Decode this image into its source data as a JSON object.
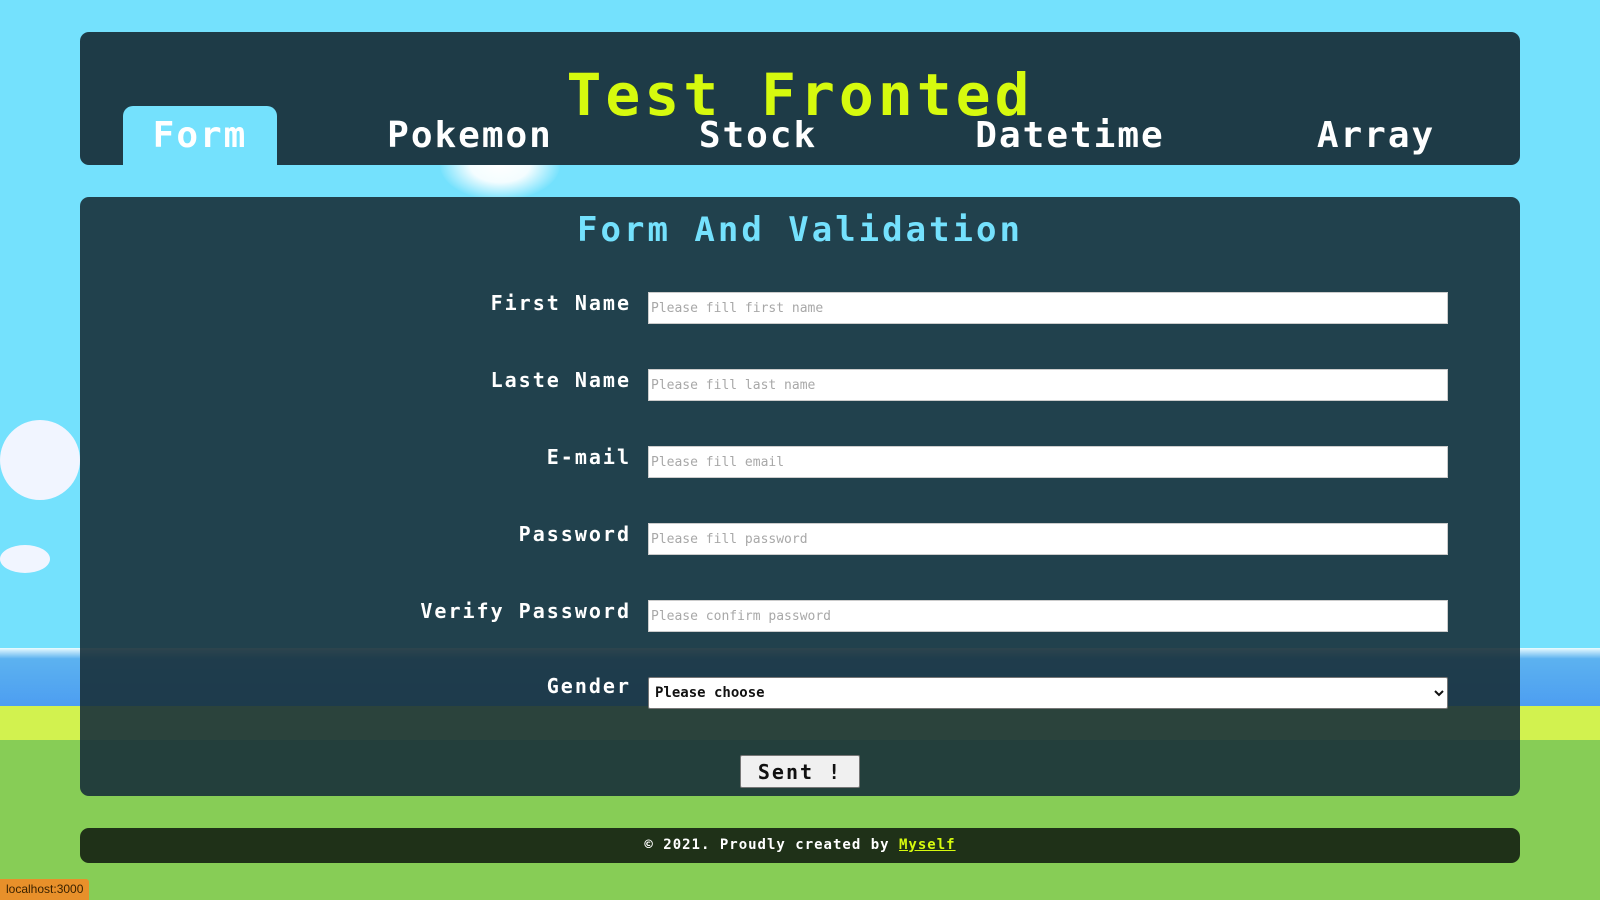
{
  "header": {
    "title": "Test Fronted",
    "tabs": [
      {
        "label": "Form",
        "active": true
      },
      {
        "label": "Pokemon",
        "active": false
      },
      {
        "label": "Stock",
        "active": false
      },
      {
        "label": "Datetime",
        "active": false
      },
      {
        "label": "Array",
        "active": false
      }
    ]
  },
  "form": {
    "title": "Form And Validation",
    "fields": [
      {
        "label": "First Name",
        "value": "",
        "placeholder": "Please fill first name"
      },
      {
        "label": "Laste Name",
        "value": "",
        "placeholder": "Please fill last name"
      },
      {
        "label": "E-mail",
        "value": "",
        "placeholder": "Please fill email"
      },
      {
        "label": "Password",
        "value": "",
        "placeholder": "Please fill password"
      },
      {
        "label": "Verify Password",
        "value": "",
        "placeholder": "Please confirm password"
      }
    ],
    "gender": {
      "label": "Gender",
      "selected": "Please choose"
    },
    "submit_label": "Sent !"
  },
  "footer": {
    "text": "© 2021. Proudly created by",
    "link_label": "Myself"
  },
  "status_bar": {
    "url": "localhost:3000"
  },
  "colors": {
    "accent": "#d6fa0e",
    "tab_active": "#74e1fd",
    "panel": "#1e3b47",
    "sky": "#74e1fd",
    "grass": "#87cd56"
  }
}
